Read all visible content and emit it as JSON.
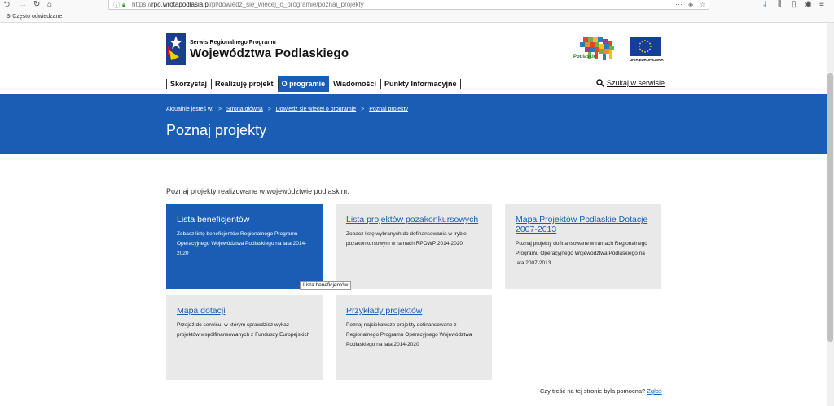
{
  "browser": {
    "url_prefix": "https://",
    "url_domain": "rpo.wrotapodlasia.pl",
    "url_path": "/pl/dowiedz_sie_wiecej_o_programie/poznaj_projekty",
    "more": "···",
    "bookmark": "Często odwiedzane"
  },
  "header": {
    "subtitle": "Serwis Regionalnego Programu",
    "title": "Województwa Podlaskiego",
    "region_logo_text": "Podlaskie",
    "eu_text": "UNIA EUROPEJSKA"
  },
  "nav": {
    "items": [
      "Skorzystaj",
      "Realizuję projekt",
      "O programie",
      "Wiadomości",
      "Punkty Informacyjne"
    ],
    "search": "Szukaj w serwisie"
  },
  "breadcrumb": {
    "label": "Aktualnie jesteś w:",
    "items": [
      "Strona główna",
      "Dowiedz się więcej o programie",
      "Poznaj projekty"
    ]
  },
  "page_title": "Poznaj projekty",
  "intro": "Poznaj projekty realizowane w województwie podlaskim:",
  "tiles": [
    {
      "title": "Lista beneficjentów",
      "desc": "Zobacz listę beneficjentów Regionalnego Programu Operacyjnego Województwa Podlaskiego na lata 2014-2020"
    },
    {
      "title": "Lista projektów pozakonkursowych",
      "desc": "Zobacz listę wybranych do dofinansowania w trybie pozakonkursowym w ramach RPOWP 2014-2020"
    },
    {
      "title": "Mapa Projektów Podlaskie Dotacje 2007-2013",
      "desc": "Poznaj projekty dofinansowane w ramach Regionalnego Programu Operacyjnego Województwa Podlaskiego na lata 2007-2013"
    },
    {
      "title": "Mapa dotacji",
      "desc": "Przejdź do serwisu, w którym sprawdzisz wykaz projektów współfinansowanych z Funduszy Europejskich"
    },
    {
      "title": "Przykłady projektów",
      "desc": "Poznaj najciekawsze projekty dofinansowane z Regionalnego Programu Operacyjnego Województwa Podlaskiego na lata 2014-2020"
    }
  ],
  "tooltip": "Lista beneficjentów",
  "feedback": {
    "question": "Czy treść na tej stronie była pomocna?",
    "link": "Zgłoś"
  }
}
